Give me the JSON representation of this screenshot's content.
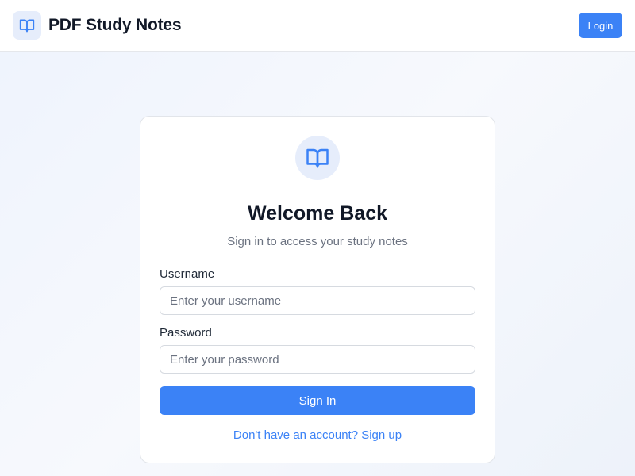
{
  "header": {
    "title": "PDF Study Notes",
    "brand_icon": "book-open-icon",
    "login_label": "Login"
  },
  "card": {
    "icon": "book-open-icon",
    "title": "Welcome Back",
    "subtitle": "Sign in to access your study notes",
    "username_label": "Username",
    "username_placeholder": "Enter your username",
    "username_value": "",
    "password_label": "Password",
    "password_placeholder": "Enter your password",
    "password_value": "",
    "signin_label": "Sign In",
    "signup_text": "Don't have an account? Sign up"
  },
  "colors": {
    "accent": "#3b82f6",
    "icon_bg": "#e6edfb",
    "text_primary": "#111827",
    "text_muted": "#6b7280"
  }
}
